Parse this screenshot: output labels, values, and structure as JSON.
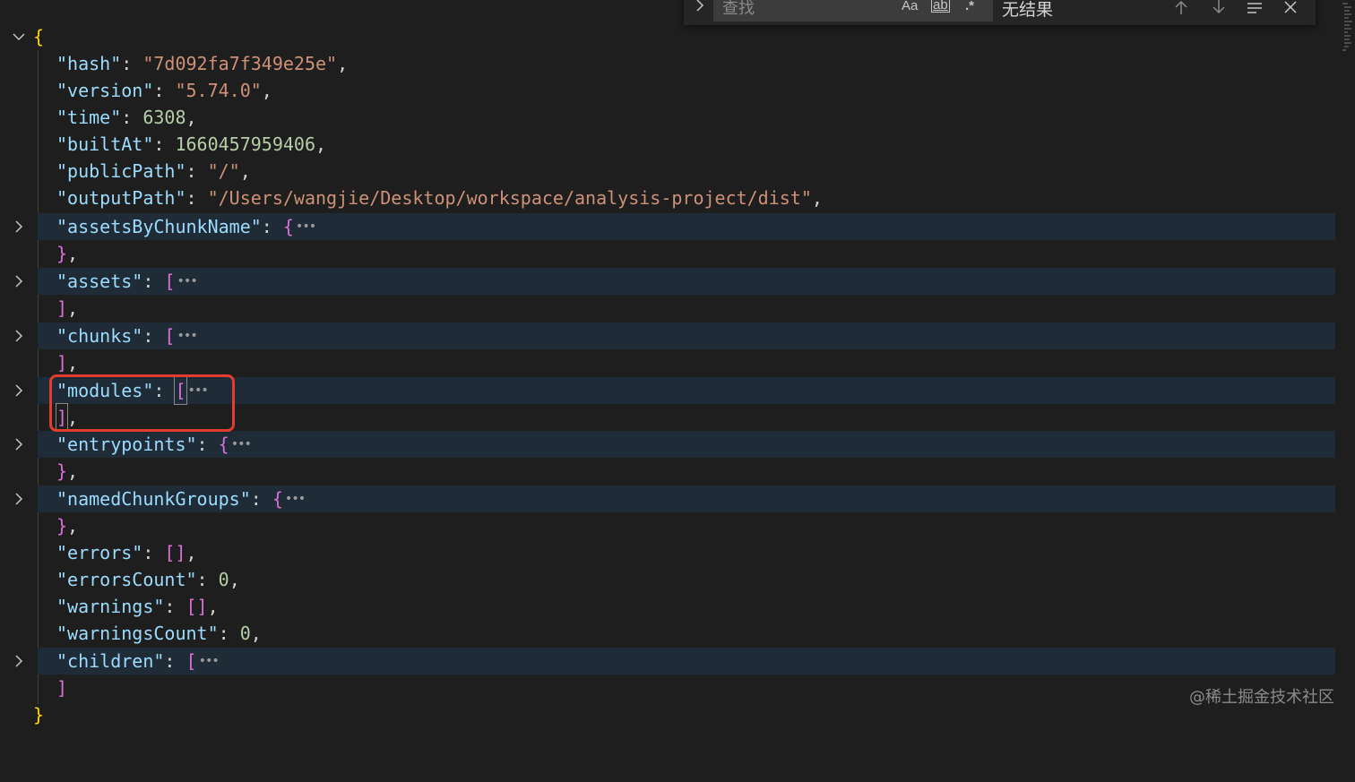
{
  "search": {
    "placeholder": "查找",
    "options": {
      "match_case": "Aa",
      "whole_word": "ab",
      "regex": ".*"
    },
    "result_text": "无结果"
  },
  "json": {
    "open_brace": "{",
    "close_brace": "}",
    "hash": {
      "key": "\"hash\"",
      "value": "\"7d092fa7f349e25e\""
    },
    "version": {
      "key": "\"version\"",
      "value": "\"5.74.0\""
    },
    "time": {
      "key": "\"time\"",
      "value": "6308"
    },
    "builtAt": {
      "key": "\"builtAt\"",
      "value": "1660457959406"
    },
    "publicPath": {
      "key": "\"publicPath\"",
      "value": "\"/\""
    },
    "outputPath": {
      "key": "\"outputPath\"",
      "value": "\"/Users/wangjie/Desktop/workspace/analysis-project/dist\""
    },
    "assetsByChunkName": {
      "key": "\"assetsByChunkName\"",
      "open": "{",
      "close": "}"
    },
    "assets": {
      "key": "\"assets\"",
      "open": "[",
      "close": "]"
    },
    "chunks": {
      "key": "\"chunks\"",
      "open": "[",
      "close": "]"
    },
    "modules": {
      "key": "\"modules\"",
      "open": "[",
      "close": "]"
    },
    "entrypoints": {
      "key": "\"entrypoints\"",
      "open": "{",
      "close": "}"
    },
    "namedChunkGroups": {
      "key": "\"namedChunkGroups\"",
      "open": "{",
      "close": "}"
    },
    "errors": {
      "key": "\"errors\"",
      "value": "[]"
    },
    "errorsCount": {
      "key": "\"errorsCount\"",
      "value": "0"
    },
    "warnings": {
      "key": "\"warnings\"",
      "value": "[]"
    },
    "warningsCount": {
      "key": "\"warningsCount\"",
      "value": "0"
    },
    "children": {
      "key": "\"children\"",
      "open": "[",
      "close": "]"
    }
  },
  "watermark": "@稀土掘金技术社区",
  "colors": {
    "editor_bg": "#1e1e1e",
    "folded_bg": "#1f2b36",
    "key": "#9cdcfe",
    "string": "#ce9178",
    "number": "#b5cea8",
    "bracket_outer": "#ffd700",
    "bracket_inner": "#da70d6",
    "highlight_box": "#e23d2d"
  }
}
